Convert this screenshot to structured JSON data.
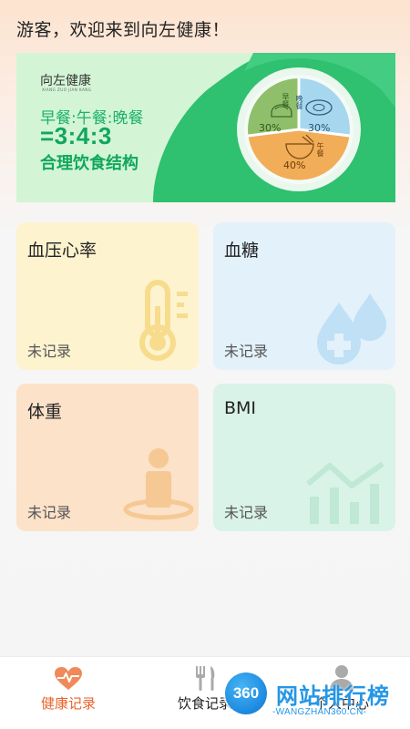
{
  "header": {
    "greeting": "游客，欢迎来到向左健康！"
  },
  "banner": {
    "logo": "向左健康",
    "logo_sub": "XIANG ZUO JIAN KANG",
    "meal_label": "早餐:午餐:晚餐",
    "ratio": "=3:4:3",
    "subtitle": "合理饮食结构",
    "pie": [
      {
        "meal": "早餐",
        "percent": "30%",
        "color": "#8fbf6a"
      },
      {
        "meal": "晚餐",
        "percent": "30%",
        "color": "#a7d7ef"
      },
      {
        "meal": "午餐",
        "percent": "40%",
        "color": "#f2ad58"
      }
    ]
  },
  "cards": [
    {
      "title": "血压心率",
      "status": "未记录",
      "icon": "thermometer-icon"
    },
    {
      "title": "血糖",
      "status": "未记录",
      "icon": "blood-drop-icon"
    },
    {
      "title": "体重",
      "status": "未记录",
      "icon": "person-scale-icon"
    },
    {
      "title": "BMI",
      "status": "未记录",
      "icon": "bar-trend-icon"
    }
  ],
  "tabbar": {
    "tabs": [
      {
        "label": "健康记录",
        "icon": "heart-pulse-icon",
        "active": true
      },
      {
        "label": "饮食记录",
        "icon": "fork-knife-icon",
        "active": false
      },
      {
        "label": "个人中心",
        "icon": "user-icon",
        "active": false
      }
    ]
  },
  "watermark": {
    "badge": "360",
    "text": "网站排行榜",
    "sub": "-WANGZHAN360.CN-"
  },
  "colors": {
    "accent": "#e8632b",
    "green": "#11a75c",
    "banner_bg": "#d3f5d6"
  }
}
